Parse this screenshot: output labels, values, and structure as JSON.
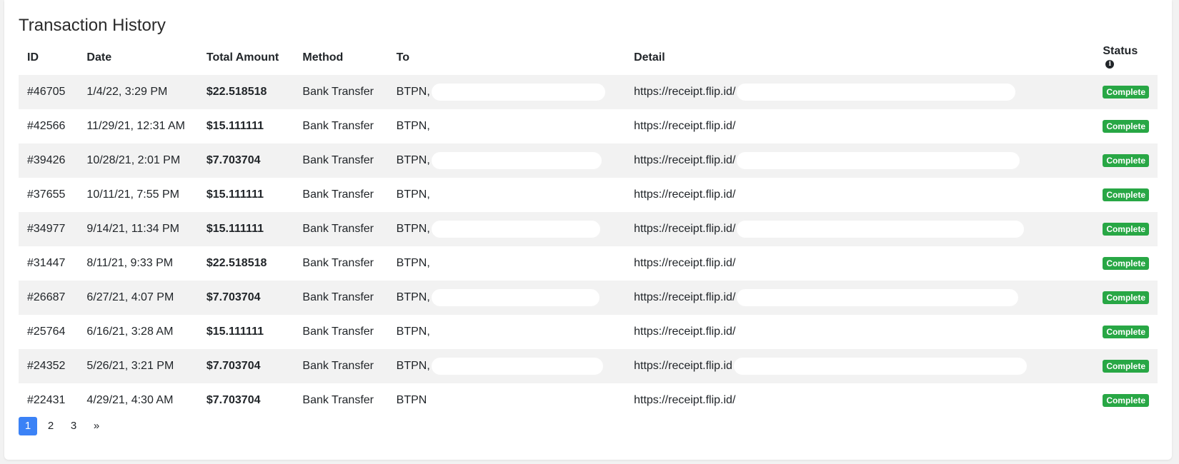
{
  "title": "Transaction History",
  "table": {
    "headers": {
      "id": "ID",
      "date": "Date",
      "amount": "Total Amount",
      "method": "Method",
      "to": "To",
      "detail": "Detail",
      "status": "Status"
    },
    "rows": [
      {
        "id": "#46705",
        "date": "1/4/22, 3:29 PM",
        "amount": "$22.518518",
        "method": "Bank Transfer",
        "to": "BTPN,",
        "detail": "https://receipt.flip.id/",
        "status": "Complete",
        "redacted": true
      },
      {
        "id": "#42566",
        "date": "11/29/21, 12:31 AM",
        "amount": "$15.111111",
        "method": "Bank Transfer",
        "to": "BTPN,",
        "detail": "https://receipt.flip.id/",
        "status": "Complete",
        "redacted": false
      },
      {
        "id": "#39426",
        "date": "10/28/21, 2:01 PM",
        "amount": "$7.703704",
        "method": "Bank Transfer",
        "to": "BTPN,",
        "detail": "https://receipt.flip.id/",
        "status": "Complete",
        "redacted": true
      },
      {
        "id": "#37655",
        "date": "10/11/21, 7:55 PM",
        "amount": "$15.111111",
        "method": "Bank Transfer",
        "to": "BTPN,",
        "detail": "https://receipt.flip.id/",
        "status": "Complete",
        "redacted": false
      },
      {
        "id": "#34977",
        "date": "9/14/21, 11:34 PM",
        "amount": "$15.111111",
        "method": "Bank Transfer",
        "to": "BTPN,",
        "detail": "https://receipt.flip.id/",
        "status": "Complete",
        "redacted": true
      },
      {
        "id": "#31447",
        "date": "8/11/21, 9:33 PM",
        "amount": "$22.518518",
        "method": "Bank Transfer",
        "to": "BTPN,",
        "detail": "https://receipt.flip.id/",
        "status": "Complete",
        "redacted": false
      },
      {
        "id": "#26687",
        "date": "6/27/21, 4:07 PM",
        "amount": "$7.703704",
        "method": "Bank Transfer",
        "to": "BTPN,",
        "detail": "https://receipt.flip.id/",
        "status": "Complete",
        "redacted": true
      },
      {
        "id": "#25764",
        "date": "6/16/21, 3:28 AM",
        "amount": "$15.111111",
        "method": "Bank Transfer",
        "to": "BTPN,",
        "detail": "https://receipt.flip.id/",
        "status": "Complete",
        "redacted": false
      },
      {
        "id": "#24352",
        "date": "5/26/21, 3:21 PM",
        "amount": "$7.703704",
        "method": "Bank Transfer",
        "to": "BTPN,",
        "detail": "https://receipt.flip.id",
        "status": "Complete",
        "redacted": true
      },
      {
        "id": "#22431",
        "date": "4/29/21, 4:30 AM",
        "amount": "$7.703704",
        "method": "Bank Transfer",
        "to": "BTPN",
        "detail": "https://receipt.flip.id/",
        "status": "Complete",
        "redacted": false
      }
    ]
  },
  "pagination": {
    "pages": [
      "1",
      "2",
      "3"
    ],
    "active": "1",
    "next": "»"
  },
  "icons": {
    "status_info": "info-icon"
  },
  "colors": {
    "status_complete": "#28a745",
    "page_active": "#3b82f6",
    "row_stripe": "#f2f2f2"
  }
}
